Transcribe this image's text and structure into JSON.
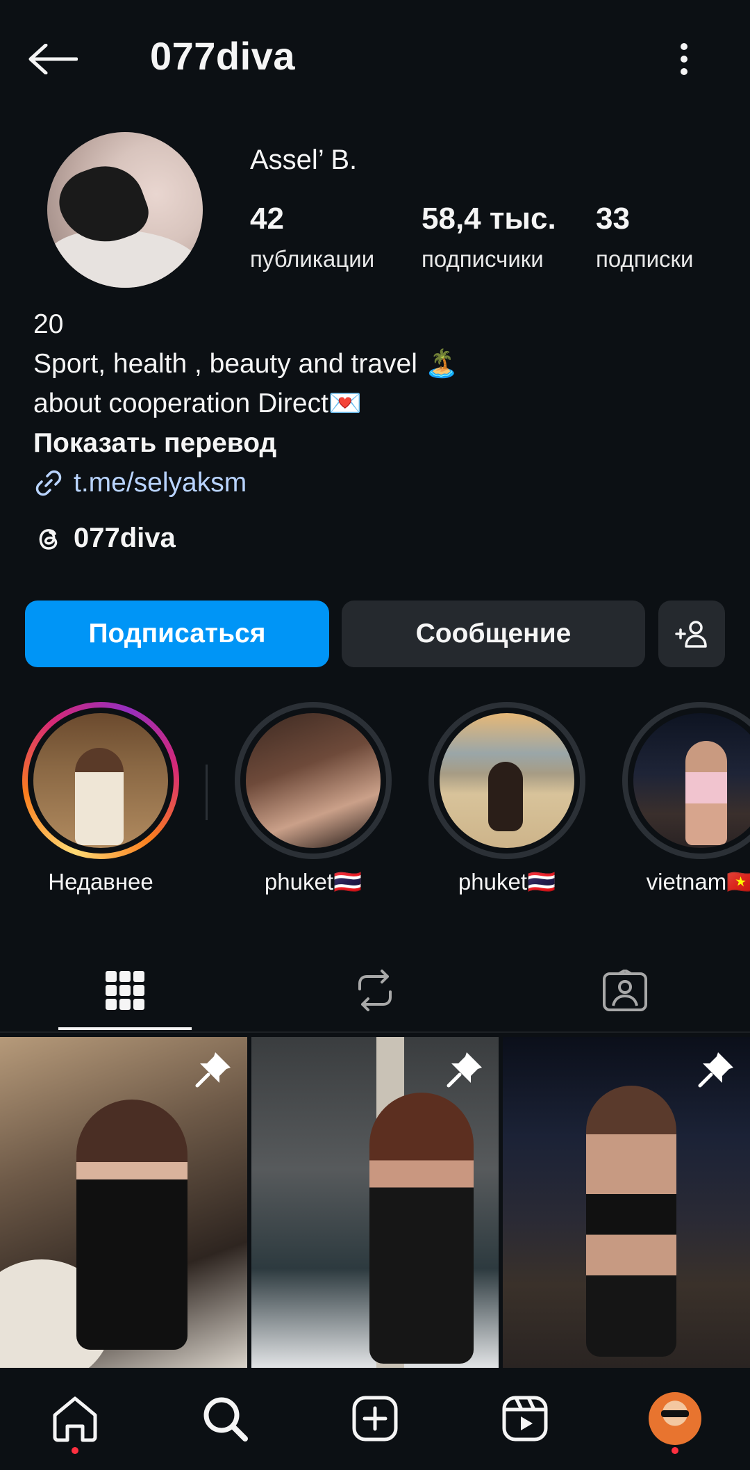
{
  "header": {
    "username": "077diva"
  },
  "profile": {
    "display_name": "Assel’ B.",
    "stats": [
      {
        "value": "42",
        "label": "публикации"
      },
      {
        "value": "58,4 тыс.",
        "label": "подписчики"
      },
      {
        "value": "33",
        "label": "подписки"
      }
    ],
    "bio_lines": [
      "20",
      "Sport, health , beauty and travel 🏝️",
      "about cooperation Direct💌"
    ],
    "show_translation": "Показать перевод",
    "link": "t.me/selyaksm",
    "threads_handle": "077diva"
  },
  "actions": {
    "follow": "Подписаться",
    "message": "Сообщение"
  },
  "highlights": [
    {
      "label": "Недавнее"
    },
    {
      "label": "phuket🇹🇭"
    },
    {
      "label": "phuket🇹🇭"
    },
    {
      "label": "vietnam🇻🇳"
    }
  ],
  "tabs": [
    {
      "icon": "grid-icon",
      "active": true
    },
    {
      "icon": "reposts-icon",
      "active": false
    },
    {
      "icon": "tagged-icon",
      "active": false
    }
  ],
  "posts": [
    {
      "pinned": true
    },
    {
      "pinned": true
    },
    {
      "pinned": true
    }
  ],
  "bottom_nav": [
    {
      "icon": "home-icon",
      "notification_dot": true
    },
    {
      "icon": "search-icon",
      "notification_dot": false
    },
    {
      "icon": "create-icon",
      "notification_dot": false
    },
    {
      "icon": "reels-icon",
      "notification_dot": false
    },
    {
      "icon": "profile-avatar",
      "notification_dot": true
    }
  ],
  "colors": {
    "background": "#0c1014",
    "primary_button": "#0095f6",
    "secondary_button": "#25292e",
    "link": "#b9d4ff",
    "notification": "#ff3040"
  }
}
